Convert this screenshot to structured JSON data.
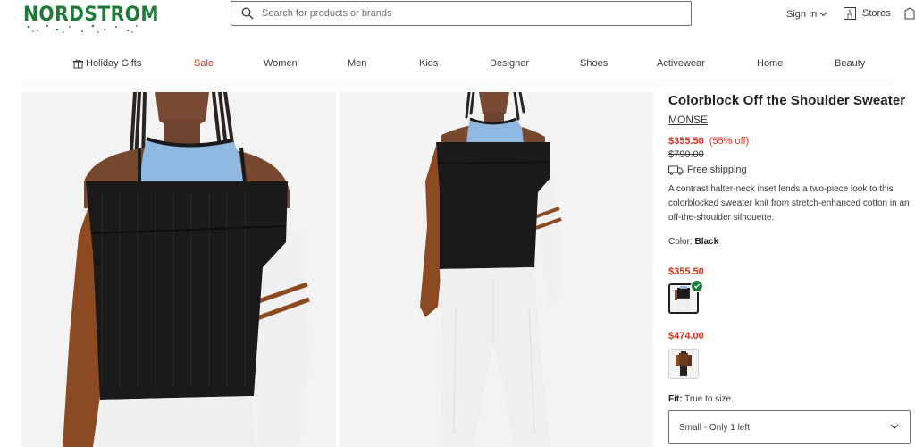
{
  "header": {
    "logo_text": "NORDSTROM",
    "search_placeholder": "Search for products or brands",
    "signin_label": "Sign In",
    "stores_label": "Stores",
    "brand_color": "#1f7a3a"
  },
  "nav": {
    "items": [
      {
        "label": "Holiday Gifts",
        "icon": "gift-icon"
      },
      {
        "label": "Sale"
      },
      {
        "label": "Women"
      },
      {
        "label": "Men"
      },
      {
        "label": "Kids"
      },
      {
        "label": "Designer"
      },
      {
        "label": "Shoes"
      },
      {
        "label": "Activewear"
      },
      {
        "label": "Home"
      },
      {
        "label": "Beauty"
      }
    ],
    "sale_color": "#d5311c"
  },
  "product": {
    "title": "Colorblock Off the Shoulder Sweater",
    "brand": "MONSE",
    "price_sale": "$355.50",
    "price_off": "(55% off)",
    "price_original": "$790.00",
    "shipping": "Free shipping",
    "description": "A contrast halter-neck inset lends a two-piece look to this colorblocked sweater knit from stretch-enhanced cotton in an off-the-shoulder silhouette.",
    "color_prefix": "Color:",
    "color_value": "Black",
    "swatches": [
      {
        "price": "$355.50",
        "selected": true
      },
      {
        "price": "$474.00",
        "selected": false
      }
    ],
    "fit_label": "Fit:",
    "fit_value": "True to size.",
    "size_selected": "Small - Only 1 left"
  }
}
